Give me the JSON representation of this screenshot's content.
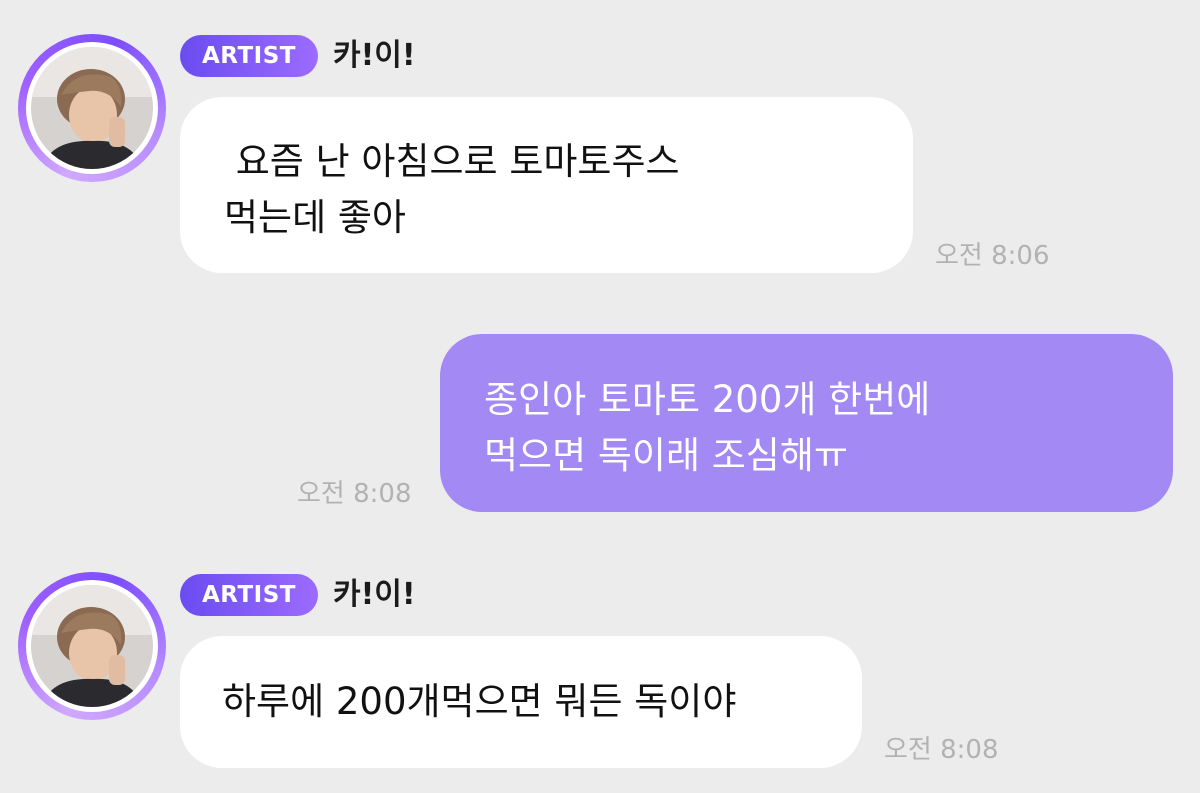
{
  "messages": [
    {
      "sender": "artist",
      "badge": "ARTIST",
      "name": "카!이!",
      "text": " 요즘 난 아침으로 토마토주스\n먹는데 좋아",
      "time": "오전 8:06"
    },
    {
      "sender": "me",
      "text": "종인아 토마토 200개 한번에\n먹으면 독이래 조심해ㅠ",
      "time": "오전 8:08"
    },
    {
      "sender": "artist",
      "badge": "ARTIST",
      "name": "카!이!",
      "text": "하루에 200개먹으면 뭐든 독이야",
      "time": "오전 8:08"
    }
  ],
  "colors": {
    "background": "#ececed",
    "incoming_bubble": "#ffffff",
    "outgoing_bubble": "#a389f3",
    "badge": "#7c5cf5",
    "timestamp": "#b2b2b2"
  },
  "icons": {
    "avatar": "artist-profile-photo"
  }
}
